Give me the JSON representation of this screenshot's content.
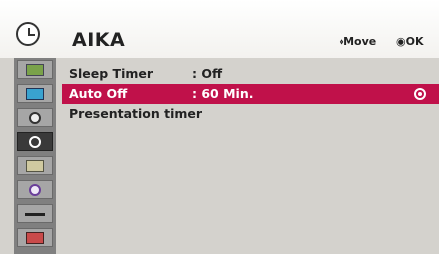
{
  "header": {
    "title": "AIKA",
    "move_hint": "⬫Move",
    "ok_hint": "◉OK"
  },
  "sidebar": {
    "items": [
      {
        "icon": "tv-icon"
      },
      {
        "icon": "picture-icon"
      },
      {
        "icon": "audio-icon"
      },
      {
        "icon": "clock-icon",
        "active": true
      },
      {
        "icon": "option-icon"
      },
      {
        "icon": "info-icon"
      },
      {
        "icon": "input-icon"
      },
      {
        "icon": "media-icon"
      }
    ]
  },
  "menu": {
    "rows": [
      {
        "label": "Sleep Timer",
        "value": ": Off"
      },
      {
        "label": "Auto Off",
        "value": ": 60 Min.",
        "selected": true
      },
      {
        "label": "Presentation timer",
        "value": ""
      }
    ]
  },
  "colors": {
    "selected_row": "#c0114a",
    "menu_background": "#d4d2cd",
    "sidebar_background": "#808080"
  }
}
